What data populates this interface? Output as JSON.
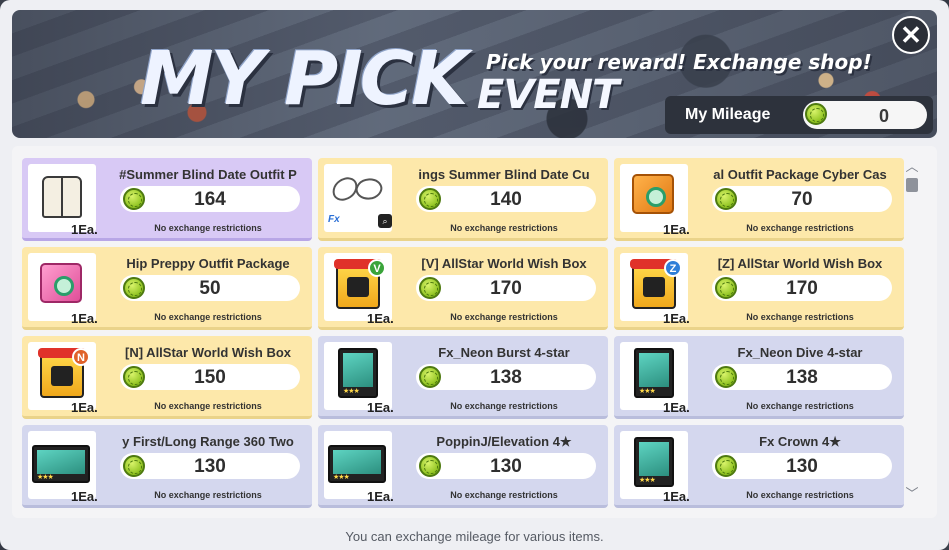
{
  "banner": {
    "title": "MY PICK",
    "title_event": "EVENT",
    "subtitle": "Pick your reward! Exchange shop!",
    "close_label": "✕"
  },
  "mileage": {
    "label": "My Mileage",
    "value": "0"
  },
  "items": [
    {
      "name": "#Summer Blind Date Outfit P",
      "price": "164",
      "qty": "1Ea.",
      "restriction": "No exchange restrictions",
      "style": "selected",
      "icon": "jacket-icon"
    },
    {
      "name": "ings    Summer Blind Date Cu",
      "price": "140",
      "qty": "",
      "restriction": "No exchange restrictions",
      "style": "yellow",
      "icon": "wings-icon",
      "tags": [
        "Fx",
        "zoom-icon"
      ]
    },
    {
      "name": "al Outfit Package    Cyber Cas",
      "price": "70",
      "qty": "1Ea.",
      "restriction": "No exchange restrictions",
      "style": "yellow",
      "icon": "orange-box-icon"
    },
    {
      "name": "Hip Preppy Outfit Package",
      "price": "50",
      "qty": "1Ea.",
      "restriction": "No exchange restrictions",
      "style": "yellow",
      "icon": "pink-box-icon"
    },
    {
      "name": "[V] AllStar World Wish Box",
      "price": "170",
      "qty": "1Ea.",
      "restriction": "No exchange restrictions",
      "style": "yellow",
      "icon": "gift-box-icon",
      "badge": "V",
      "badge_color": "#3aa43a"
    },
    {
      "name": "[Z] AllStar World Wish Box",
      "price": "170",
      "qty": "1Ea.",
      "restriction": "No exchange restrictions",
      "style": "yellow",
      "icon": "gift-box-icon",
      "badge": "Z",
      "badge_color": "#2f7fd8"
    },
    {
      "name": "[N] AllStar World Wish Box",
      "price": "150",
      "qty": "1Ea.",
      "restriction": "No exchange restrictions",
      "style": "yellow",
      "icon": "gift-box-icon",
      "badge": "N",
      "badge_color": "#e0622a"
    },
    {
      "name": "Fx_Neon Burst 4-star",
      "price": "138",
      "qty": "1Ea.",
      "restriction": "No exchange restrictions",
      "style": "blue",
      "icon": "card-icon"
    },
    {
      "name": "Fx_Neon Dive 4-star",
      "price": "138",
      "qty": "1Ea.",
      "restriction": "No exchange restrictions",
      "style": "blue",
      "icon": "card-icon"
    },
    {
      "name": "y First/Long Range 360 Two",
      "price": "130",
      "qty": "1Ea.",
      "restriction": "No exchange restrictions",
      "style": "blue",
      "icon": "wide-card-icon"
    },
    {
      "name": "PoppinJ/Elevation 4★",
      "price": "130",
      "qty": "1Ea.",
      "restriction": "No exchange restrictions",
      "style": "blue",
      "icon": "wide-card-icon"
    },
    {
      "name": "Fx Crown 4★",
      "price": "130",
      "qty": "1Ea.",
      "restriction": "No exchange restrictions",
      "style": "blue",
      "icon": "card-icon"
    }
  ],
  "scroll": {
    "up": "︿",
    "down": "﹀"
  },
  "footer": "You can exchange mileage for various items."
}
